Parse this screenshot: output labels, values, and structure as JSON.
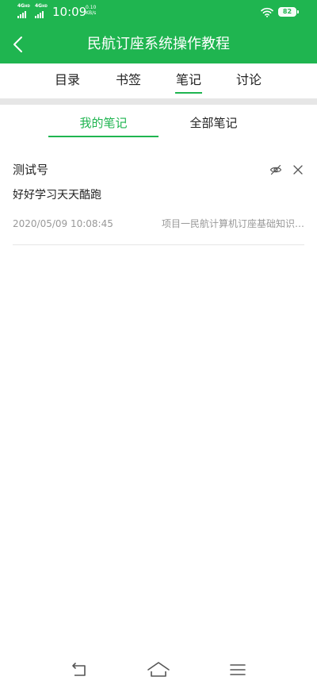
{
  "status_bar": {
    "network_1": "4G",
    "network_1_suffix": "HD",
    "network_2": "4G",
    "network_2_suffix": "HD",
    "time": "10:09",
    "speed_value": "0.10",
    "speed_unit": "KB/s",
    "battery": "82"
  },
  "header": {
    "title": "民航订座系统操作教程",
    "back_icon": "chevron-left-icon",
    "background_color": "#1fb550"
  },
  "tabs": [
    {
      "label": "目录",
      "active": false
    },
    {
      "label": "书签",
      "active": false
    },
    {
      "label": "笔记",
      "active": true
    },
    {
      "label": "讨论",
      "active": false
    }
  ],
  "subtabs": [
    {
      "label": "我的笔记",
      "active": true
    },
    {
      "label": "全部笔记",
      "active": false
    }
  ],
  "notes": [
    {
      "author": "测试号",
      "content": "好好学习天天酷跑",
      "date": "2020/05/09 10:08:45",
      "source": "项目一民航计算机订座基础知识…"
    }
  ],
  "accent_color": "#1fb550",
  "nav_bar": {
    "back_icon": "back-arrow-icon",
    "home_icon": "home-icon",
    "menu_icon": "menu-icon"
  }
}
